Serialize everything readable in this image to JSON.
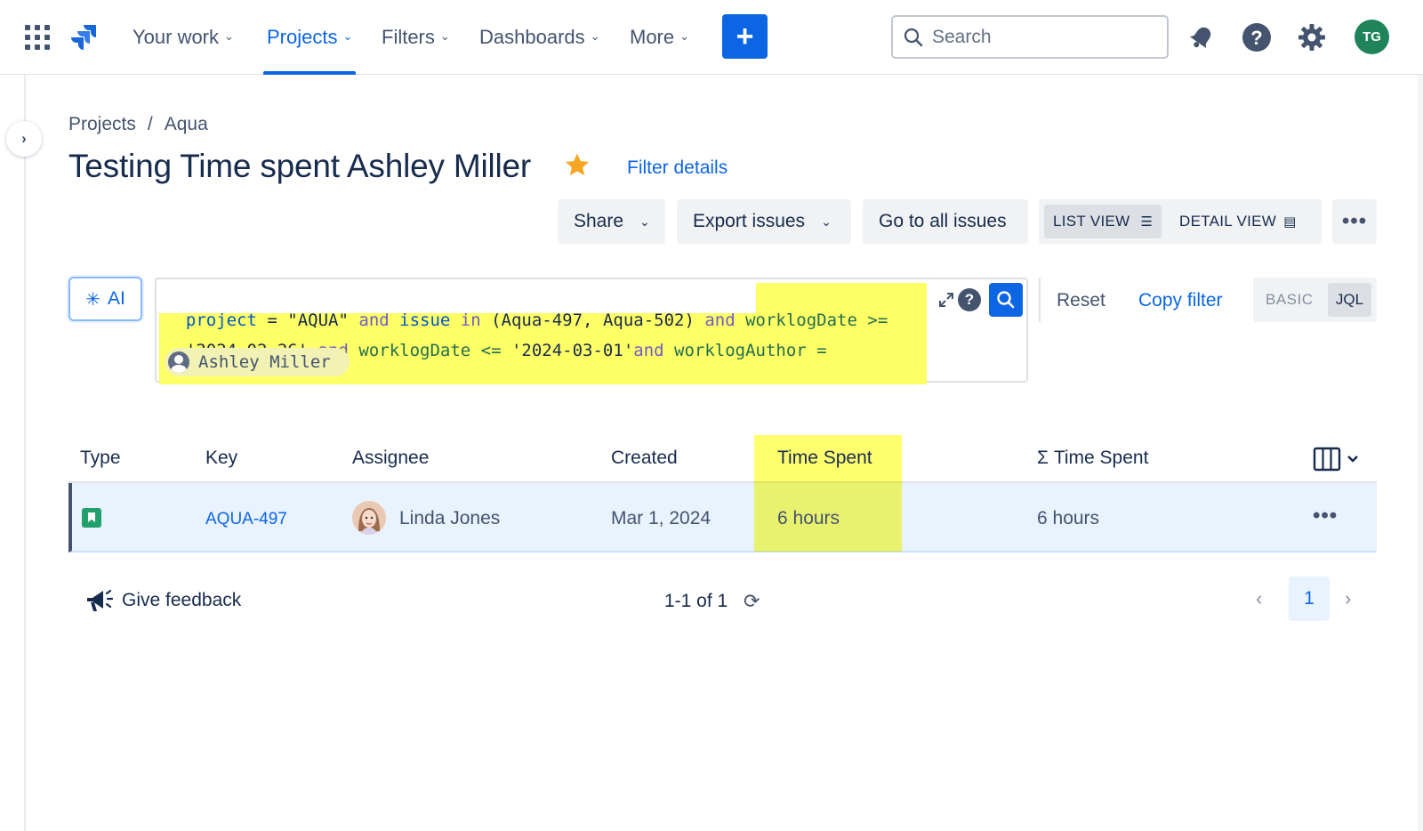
{
  "topnav": {
    "items": [
      {
        "label": "Your work"
      },
      {
        "label": "Projects",
        "active": true
      },
      {
        "label": "Filters"
      },
      {
        "label": "Dashboards"
      },
      {
        "label": "More"
      }
    ],
    "create_label": "+",
    "search_placeholder": "Search",
    "avatar_initials": "TG",
    "avatar_color": "#1f845a",
    "accent_color": "#0c66e4",
    "icons": [
      "app-switcher-icon",
      "jira-logo-icon",
      "notifications-bell-icon",
      "help-icon",
      "settings-gear-icon"
    ]
  },
  "breadcrumb": {
    "projects": "Projects",
    "separator": "/",
    "project": "Aqua"
  },
  "page": {
    "title": "Testing Time spent Ashley Miller",
    "starred": true,
    "filter_details_label": "Filter details"
  },
  "actions": {
    "share": "Share",
    "export": "Export issues",
    "go_to_all": "Go to all issues",
    "list_view": "LIST VIEW",
    "detail_view": "DETAIL VIEW",
    "more": "•••"
  },
  "jql": {
    "ai_label": "AI",
    "line1": {
      "t1": "project",
      "t2": " = ",
      "t3": "\"AQUA\"",
      "t4": " and ",
      "t5": "issue",
      "t6": " in ",
      "t7": "(Aqua-497, Aqua-502)",
      "t8": " and ",
      "t9": "worklogDate",
      "t10": " >="
    },
    "line2": {
      "t1": "'2024-02-26'",
      "t2": " and ",
      "t3": "worklogDate",
      "t4": " <= ",
      "t5": "'2024-03-01'",
      "t6": "and ",
      "t7": "worklogAuthor",
      "t8": " ="
    },
    "author_chip": "Ashley Miller",
    "highlight_color": "#ffff66",
    "reset": "Reset",
    "copy_filter": "Copy filter",
    "mode_basic": "BASIC",
    "mode_jql": "JQL"
  },
  "table": {
    "headers": {
      "type": "Type",
      "key": "Key",
      "assignee": "Assignee",
      "created": "Created",
      "time_spent": "Time Spent",
      "sum_time_spent": "Σ Time Spent"
    },
    "rows": [
      {
        "type": "story",
        "key": "AQUA-497",
        "assignee": "Linda Jones",
        "created": "Mar 1, 2024",
        "time_spent": "6 hours",
        "sum_time_spent": "6 hours",
        "more": "•••"
      }
    ]
  },
  "footer": {
    "feedback": "Give feedback",
    "count": "1-1 of 1",
    "current_page": "1"
  }
}
